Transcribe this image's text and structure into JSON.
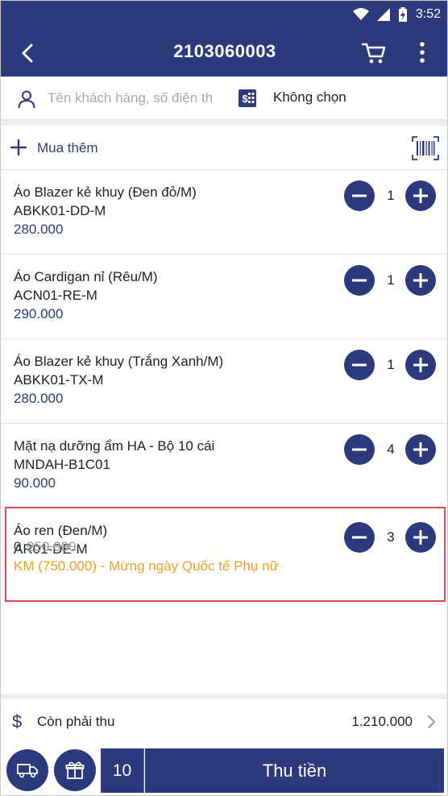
{
  "status_bar": {
    "time": "3:52"
  },
  "header": {
    "title": "2103060003"
  },
  "customer": {
    "placeholder": "Tên khách hàng, số điện th",
    "pricelist_label": "Không chọn"
  },
  "add_more": {
    "label": "Mua thêm"
  },
  "items": [
    {
      "name": "Áo Blazer kẻ khuy (Đen đỏ/M)",
      "code": "ABKK01-DD-M",
      "price": "280.000",
      "qty": "1"
    },
    {
      "name": "Áo Cardigan nỉ (Rêu/M)",
      "code": "ACN01-RE-M",
      "price": "290.000",
      "qty": "1"
    },
    {
      "name": "Áo Blazer kẻ khuy (Trắng Xanh/M)",
      "code": "ABKK01-TX-M",
      "price": "280.000",
      "qty": "1"
    },
    {
      "name": "Mặt nạ dưỡng ẩm HA - Bộ 10 cái",
      "code": "MNDAH-B1C01",
      "price": "90.000",
      "qty": "4"
    },
    {
      "name": "Áo ren (Đen/M)",
      "code": "AR01-DE-M",
      "price": "0",
      "old_price": "250.000",
      "qty": "3",
      "promo": "KM (750.000) - Mừng ngày Quốc tế Phụ nữ"
    }
  ],
  "summary": {
    "remaining_label": "Còn phải thu",
    "remaining_value": "1.210.000"
  },
  "bottom": {
    "total_qty": "10",
    "pay_label": "Thu tiền"
  },
  "colors": {
    "primary": "#2b3a7d",
    "promo": "#f0a020",
    "highlight_border": "#e0484b"
  }
}
